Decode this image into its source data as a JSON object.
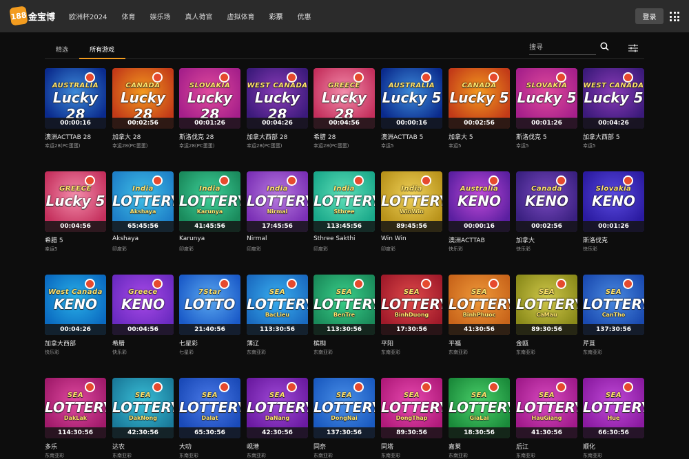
{
  "header": {
    "logo_number": "188",
    "logo_text": "金宝博",
    "nav": [
      "欧洲杯2024",
      "体育",
      "娱乐场",
      "真人荷官",
      "虚拟体育",
      "彩票",
      "优惠"
    ],
    "active_nav": "彩票",
    "login_label": "登录",
    "menu_icon": "grid-menu-icon"
  },
  "tabs": {
    "items": [
      "精选",
      "所有游戏"
    ],
    "active": "所有游戏"
  },
  "search": {
    "placeholder": "搜寻",
    "value": "",
    "icon": "search-icon",
    "filter_icon": "filter-icon"
  },
  "colors": {
    "accent": "#f39c1f",
    "background": "#0d0d0d",
    "topbar": "#2b2b2b"
  },
  "games": [
    {
      "name": "澳洲ACTTAB 28",
      "category": "幸运28(PC蛋蛋)",
      "timer": "00:00:16",
      "thumb_top": "AUSTRALIA",
      "thumb_main": "Lucky 28",
      "thumb_sub": "",
      "bg": [
        "#0a2a8c",
        "#3d8bd9"
      ]
    },
    {
      "name": "加拿大 28",
      "category": "幸运28(PC蛋蛋)",
      "timer": "00:02:56",
      "thumb_top": "CANADA",
      "thumb_main": "Lucky 28",
      "thumb_sub": "",
      "bg": [
        "#c23a18",
        "#f39a1f"
      ]
    },
    {
      "name": "斯洛伐克 28",
      "category": "幸运28(PC蛋蛋)",
      "timer": "00:01:26",
      "thumb_top": "SLOVAKIA",
      "thumb_main": "Lucky 28",
      "thumb_sub": "",
      "bg": [
        "#a51f8a",
        "#e04a9c"
      ]
    },
    {
      "name": "加拿大西部 28",
      "category": "幸运28(PC蛋蛋)",
      "timer": "00:04:26",
      "thumb_top": "WEST CANADA",
      "thumb_main": "Lucky 28",
      "thumb_sub": "",
      "bg": [
        "#3b1a7a",
        "#8a3bb7"
      ]
    },
    {
      "name": "希腊 28",
      "category": "幸运28(PC蛋蛋)",
      "timer": "00:04:56",
      "thumb_top": "GREECE",
      "thumb_main": "Lucky 28",
      "thumb_sub": "",
      "bg": [
        "#c42f5c",
        "#f38cab"
      ]
    },
    {
      "name": "澳洲ACTTAB 5",
      "category": "幸运5",
      "timer": "00:00:16",
      "thumb_top": "AUSTRALIA",
      "thumb_main": "Lucky 5",
      "thumb_sub": "",
      "bg": [
        "#0a2a8c",
        "#3d8bd9"
      ]
    },
    {
      "name": "加拿大 5",
      "category": "幸运5",
      "timer": "00:02:56",
      "thumb_top": "CANADA",
      "thumb_main": "Lucky 5",
      "thumb_sub": "",
      "bg": [
        "#c23a18",
        "#f39a1f"
      ]
    },
    {
      "name": "斯洛伐克 5",
      "category": "幸运5",
      "timer": "00:01:26",
      "thumb_top": "SLOVAKIA",
      "thumb_main": "Lucky 5",
      "thumb_sub": "",
      "bg": [
        "#a51f8a",
        "#e04a9c"
      ]
    },
    {
      "name": "加拿大西部 5",
      "category": "幸运5",
      "timer": "00:04:26",
      "thumb_top": "WEST CANADA",
      "thumb_main": "Lucky 5",
      "thumb_sub": "",
      "bg": [
        "#3b1a7a",
        "#8a3bb7"
      ]
    },
    {
      "name": "希腊 5",
      "category": "幸运5",
      "timer": "00:04:56",
      "thumb_top": "GREECE",
      "thumb_main": "Lucky 5",
      "thumb_sub": "",
      "bg": [
        "#c42f5c",
        "#f38cab"
      ]
    },
    {
      "name": "Akshaya",
      "category": "印度彩",
      "timer": "65:45:56",
      "thumb_top": "India",
      "thumb_main": "LOTTERY",
      "thumb_sub": "Akshaya",
      "bg": [
        "#1e7fc7",
        "#40c0e8"
      ]
    },
    {
      "name": "Karunya",
      "category": "印度彩",
      "timer": "41:45:56",
      "thumb_top": "India",
      "thumb_main": "LOTTERY",
      "thumb_sub": "Karunya",
      "bg": [
        "#1a8a5c",
        "#3fd19a"
      ]
    },
    {
      "name": "Nirmal",
      "category": "印度彩",
      "timer": "17:45:56",
      "thumb_top": "India",
      "thumb_main": "LOTTERY",
      "thumb_sub": "Nirmal",
      "bg": [
        "#7a2fb5",
        "#b97be0"
      ]
    },
    {
      "name": "Sthree Sakthi",
      "category": "印度彩",
      "timer": "113:45:56",
      "thumb_top": "India",
      "thumb_main": "LOTTERY",
      "thumb_sub": "Sthree",
      "bg": [
        "#1aa88a",
        "#5fe0b8"
      ]
    },
    {
      "name": "Win Win",
      "category": "印度彩",
      "timer": "89:45:56",
      "thumb_top": "India",
      "thumb_main": "LOTTERY",
      "thumb_sub": "WinWin",
      "bg": [
        "#b8921a",
        "#f0d25a"
      ]
    },
    {
      "name": "澳洲ACTTAB",
      "category": "快乐彩",
      "timer": "00:00:16",
      "thumb_top": "Australia",
      "thumb_main": "KENO",
      "thumb_sub": "",
      "bg": [
        "#5a1fa0",
        "#c04ad8"
      ]
    },
    {
      "name": "加拿大",
      "category": "快乐彩",
      "timer": "00:02:56",
      "thumb_top": "Canada",
      "thumb_main": "KENO",
      "thumb_sub": "",
      "bg": [
        "#3a2080",
        "#7a4ac0"
      ]
    },
    {
      "name": "斯洛伐克",
      "category": "快乐彩",
      "timer": "00:01:26",
      "thumb_top": "Slovakia",
      "thumb_main": "KENO",
      "thumb_sub": "",
      "bg": [
        "#2a1aa0",
        "#5a4ae0"
      ]
    },
    {
      "name": "加拿大西部",
      "category": "快乐彩",
      "timer": "00:04:26",
      "thumb_top": "West Canada",
      "thumb_main": "KENO",
      "thumb_sub": "",
      "bg": [
        "#0a6ac0",
        "#2ab0e8"
      ]
    },
    {
      "name": "希腊",
      "category": "快乐彩",
      "timer": "00:04:56",
      "thumb_top": "Greece",
      "thumb_main": "KENO",
      "thumb_sub": "",
      "bg": [
        "#6a2ac0",
        "#a84ae8"
      ]
    },
    {
      "name": "七星彩",
      "category": "七星彩",
      "timer": "21:40:56",
      "thumb_top": "7Star",
      "thumb_main": "LOTTO",
      "thumb_sub": "",
      "bg": [
        "#1a5ac8",
        "#5aa8f0"
      ]
    },
    {
      "name": "薄辽",
      "category": "东南亚彩",
      "timer": "113:30:56",
      "thumb_top": "SEA",
      "thumb_main": "LOTTERY",
      "thumb_sub": "BacLieu",
      "bg": [
        "#1a6ac0",
        "#3ab0f0"
      ]
    },
    {
      "name": "槟椥",
      "category": "东南亚彩",
      "timer": "113:30:56",
      "thumb_top": "SEA",
      "thumb_main": "LOTTERY",
      "thumb_sub": "BenTre",
      "bg": [
        "#1a8a5a",
        "#3ad08a"
      ]
    },
    {
      "name": "平阳",
      "category": "东南亚彩",
      "timer": "17:30:56",
      "thumb_top": "SEA",
      "thumb_main": "LOTTERY",
      "thumb_sub": "BinhDuong",
      "bg": [
        "#a01a2a",
        "#e04a4a"
      ]
    },
    {
      "name": "平福",
      "category": "东南亚彩",
      "timer": "41:30:56",
      "thumb_top": "SEA",
      "thumb_main": "LOTTERY",
      "thumb_sub": "BinhPhuoc",
      "bg": [
        "#c8641a",
        "#f09a3a"
      ]
    },
    {
      "name": "金瓯",
      "category": "东南亚彩",
      "timer": "89:30:56",
      "thumb_top": "SEA",
      "thumb_main": "LOTTERY",
      "thumb_sub": "CaMau",
      "bg": [
        "#8a8a1a",
        "#d0c84a"
      ]
    },
    {
      "name": "芹苴",
      "category": "东南亚彩",
      "timer": "137:30:56",
      "thumb_top": "SEA",
      "thumb_main": "LOTTERY",
      "thumb_sub": "CanTho",
      "bg": [
        "#1a4ab0",
        "#4a8ae0"
      ]
    },
    {
      "name": "多乐",
      "category": "东南亚彩",
      "timer": "114:30:56",
      "thumb_top": "SEA",
      "thumb_main": "LOTTERY",
      "thumb_sub": "DakLak",
      "bg": [
        "#a01a6a",
        "#e04aa0"
      ]
    },
    {
      "name": "达农",
      "category": "东南亚彩",
      "timer": "42:30:56",
      "thumb_top": "SEA",
      "thumb_main": "LOTTERY",
      "thumb_sub": "DakNong",
      "bg": [
        "#1a7a9a",
        "#3ac0d8"
      ]
    },
    {
      "name": "大叻",
      "category": "东南亚彩",
      "timer": "65:30:56",
      "thumb_top": "SEA",
      "thumb_main": "LOTTERY",
      "thumb_sub": "Dalat",
      "bg": [
        "#1a4ab8",
        "#4a7ae8"
      ]
    },
    {
      "name": "岘港",
      "category": "东南亚彩",
      "timer": "42:30:56",
      "thumb_top": "SEA",
      "thumb_main": "LOTTERY",
      "thumb_sub": "DaNang",
      "bg": [
        "#6a1aa0",
        "#a04ad8"
      ]
    },
    {
      "name": "同奈",
      "category": "东南亚彩",
      "timer": "137:30:56",
      "thumb_top": "SEA",
      "thumb_main": "LOTTERY",
      "thumb_sub": "DongNai",
      "bg": [
        "#1a5ac0",
        "#4a90e8"
      ]
    },
    {
      "name": "同塔",
      "category": "东南亚彩",
      "timer": "89:30:56",
      "thumb_top": "SEA",
      "thumb_main": "LOTTERY",
      "thumb_sub": "DongThap",
      "bg": [
        "#b01a7a",
        "#e84ab0"
      ]
    },
    {
      "name": "嘉莱",
      "category": "东南亚彩",
      "timer": "18:30:56",
      "thumb_top": "SEA",
      "thumb_main": "LOTTERY",
      "thumb_sub": "GiaLai",
      "bg": [
        "#1a8a3a",
        "#4ad06a"
      ]
    },
    {
      "name": "后江",
      "category": "东南亚彩",
      "timer": "41:30:56",
      "thumb_top": "SEA",
      "thumb_main": "LOTTERY",
      "thumb_sub": "HauGiang",
      "bg": [
        "#a01a8a",
        "#d84ac0"
      ]
    },
    {
      "name": "顺化",
      "category": "东南亚彩",
      "timer": "66:30:56",
      "thumb_top": "SEA",
      "thumb_main": "LOTTERY",
      "thumb_sub": "Hue",
      "bg": [
        "#8a1aa0",
        "#c04ad8"
      ]
    }
  ]
}
